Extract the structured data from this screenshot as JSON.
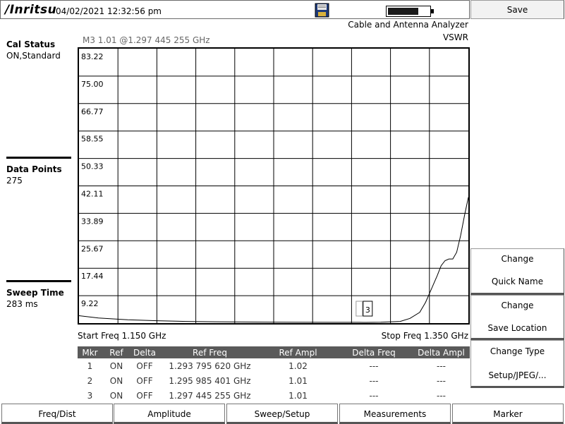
{
  "header": {
    "logo": "/Inritsu",
    "datetime": "04/02/2021 12:32:56 pm",
    "battery_level": 0.85
  },
  "left_panel": {
    "cal_status": {
      "title": "Cal Status",
      "value": "ON,Standard"
    },
    "data_points": {
      "title": "Data Points",
      "value": "275"
    },
    "sweep_time": {
      "title": "Sweep Time",
      "value": "283 ms"
    }
  },
  "graph": {
    "analyzer_title": "Cable and Antenna Analyzer",
    "measurement": "VSWR",
    "marker_readout": "M3 1.01 @1.297 445 255 GHz",
    "start_freq": "Start Freq 1.150 GHz",
    "stop_freq": "Stop Freq 1.350 GHz",
    "marker_label": "3"
  },
  "chart_data": {
    "type": "line",
    "xlabel": "",
    "ylabel": "",
    "xlim": [
      1.15,
      1.35
    ],
    "ylim": [
      1.0,
      83.22
    ],
    "y_ticks": [
      "83.22",
      "75.00",
      "66.77",
      "58.55",
      "50.33",
      "42.11",
      "33.89",
      "25.67",
      "17.44",
      "9.22"
    ],
    "grid": true,
    "series": [
      {
        "x": [
          1.15,
          1.16,
          1.175,
          1.19,
          1.205,
          1.22,
          1.24,
          1.26,
          1.28,
          1.2937,
          1.296,
          1.2974,
          1.305,
          1.315,
          1.32,
          1.325,
          1.328,
          1.331,
          1.334,
          1.336,
          1.338,
          1.34,
          1.342,
          1.344,
          1.346,
          1.348,
          1.35
        ],
        "y": [
          3.0,
          2.3,
          1.8,
          1.5,
          1.3,
          1.2,
          1.1,
          1.05,
          1.02,
          1.02,
          1.01,
          1.01,
          1.05,
          1.3,
          2.2,
          4.0,
          7.0,
          11.0,
          15.0,
          18.0,
          19.5,
          20.0,
          20.0,
          22.0,
          27.0,
          33.0,
          38.5
        ]
      }
    ]
  },
  "marker_table": {
    "headers": [
      "Mkr",
      "Ref",
      "Delta",
      "Ref Freq",
      "Ref Ampl",
      "Delta Freq",
      "Delta Ampl"
    ],
    "rows": [
      [
        "1",
        "ON",
        "OFF",
        "1.293 795 620 GHz",
        "1.02",
        "---",
        "---"
      ],
      [
        "2",
        "ON",
        "OFF",
        "1.295 985 401 GHz",
        "1.01",
        "---",
        "---"
      ],
      [
        "3",
        "ON",
        "OFF",
        "1.297 445 255 GHz",
        "1.01",
        "---",
        "---"
      ]
    ]
  },
  "softkeys": {
    "save": "Save",
    "change_quick_name": [
      "Change",
      "Quick Name"
    ],
    "change_save_location": [
      "Change",
      "Save Location"
    ],
    "change_type": [
      "Change Type",
      "Setup/JPEG/..."
    ]
  },
  "bottom_menu": [
    "Freq/Dist",
    "Amplitude",
    "Sweep/Setup",
    "Measurements",
    "Marker"
  ]
}
